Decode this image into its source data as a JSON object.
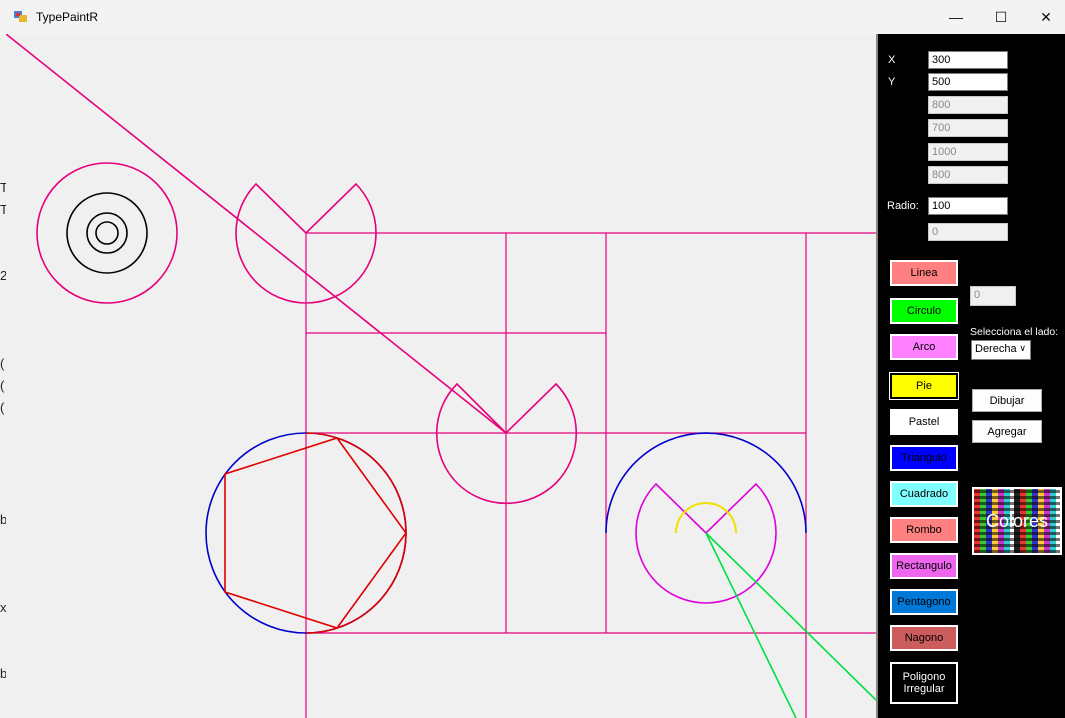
{
  "window": {
    "title": "TypePaintR",
    "minimize": "—",
    "maximize": "☐",
    "close": "✕"
  },
  "left_strip_chars": [
    "T",
    "T",
    "2",
    "(",
    "(",
    "(",
    "b",
    "x",
    "b"
  ],
  "fields": {
    "x_label": "X",
    "x_value": "300",
    "y_label": "Y",
    "y_value": "500",
    "f3": "800",
    "f4": "700",
    "f5": "1000",
    "f6": "800",
    "radio_label": "Radio:",
    "radio_value": "100",
    "f8": "0",
    "side_value": "0"
  },
  "side_prompt": "Selecciona el lado:",
  "side_select": "Derecha",
  "shape_buttons": [
    {
      "label": "Linea",
      "color": "#ff8080",
      "text": "#000000"
    },
    {
      "label": "Circulo",
      "color": "#00ff00",
      "text": "#000000"
    },
    {
      "label": "Arco",
      "color": "#ff80ff",
      "text": "#000000"
    },
    {
      "label": "Pie",
      "color": "#ffff00",
      "text": "#000000"
    },
    {
      "label": "Pastel",
      "color": "#ffffff",
      "text": "#000000"
    },
    {
      "label": "Triangulo",
      "color": "#0000ff",
      "text": "#000000"
    },
    {
      "label": "Cuadrado",
      "color": "#80ffff",
      "text": "#000000"
    },
    {
      "label": "Rombo",
      "color": "#ff8080",
      "text": "#000000"
    },
    {
      "label": "Rectangulo",
      "color": "#ee66ee",
      "text": "#000000"
    },
    {
      "label": "Pentagono",
      "color": "#0078d7",
      "text": "#000000"
    },
    {
      "label": "Nagono",
      "color": "#cd5c5c",
      "text": "#000000"
    },
    {
      "label": "Poligono Irregular",
      "color": "#000000",
      "text": "#ffffff"
    }
  ],
  "actions": {
    "draw": "Dibujar",
    "add": "Agregar"
  },
  "colors_button": "Colores",
  "colors": {
    "magenta": "#e6007e",
    "black": "#000000",
    "blue": "#0000cc",
    "red": "#e00000",
    "yellow": "#f0e000",
    "green": "#00e040",
    "violet": "#dd00dd"
  }
}
